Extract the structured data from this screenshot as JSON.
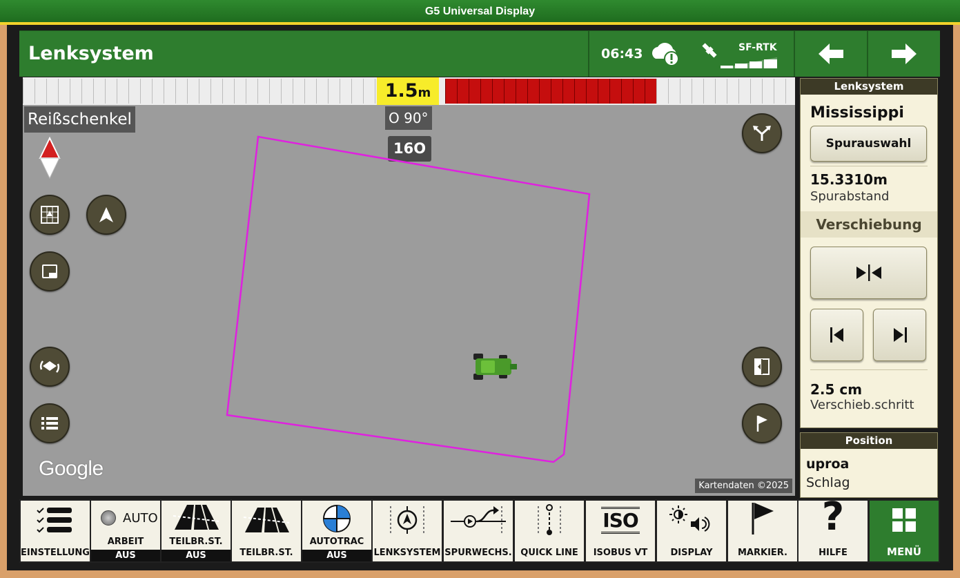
{
  "window": {
    "title": "G5 Universal Display"
  },
  "header": {
    "title": "Lenksystem",
    "time": "06:43",
    "gps_status": "SF-RTK",
    "icons": [
      "cloud-warning-icon",
      "satellite-icon",
      "signal-bars-icon"
    ],
    "back_label": "←",
    "forward_label": "→"
  },
  "map": {
    "lightbar_value": "1.5",
    "lightbar_unit": "m",
    "implement_label": "Reißschenkel",
    "heading_label": "O 90°",
    "track_number": "16O",
    "google_label": "Google",
    "credit": "Kartendaten ©2025",
    "boundary_color": "#e020e0",
    "lightbar_error_color": "#c50e0e"
  },
  "sidepanel": {
    "header": "Lenksystem",
    "track_name": "Mississippi",
    "track_select_label": "Spurauswahl",
    "spacing_value": "15.3310m",
    "spacing_label": "Spurabstand",
    "shift_header": "Verschiebung",
    "step_value": "2.5 cm",
    "step_label": "Verschieb.schritt"
  },
  "position_panel": {
    "header": "Position",
    "field_name": "uproa",
    "field_label": "Schlag"
  },
  "toolbar": {
    "items": [
      {
        "label": "EINSTELLUNG"
      },
      {
        "top": "AUTO",
        "label": "ARBEIT",
        "sub": "AUS"
      },
      {
        "label": "TEILBR.ST.",
        "sub": "AUS"
      },
      {
        "label": "TEILBR.ST."
      },
      {
        "label": "AUTOTRAC",
        "sub": "AUS"
      },
      {
        "label": "LENKSYSTEM"
      },
      {
        "label": "SPURWECHS."
      },
      {
        "label": "QUICK LINE"
      },
      {
        "top": "ISO",
        "label": "ISOBUS VT"
      },
      {
        "label": "DISPLAY"
      },
      {
        "label": "MARKIER."
      },
      {
        "top": "?",
        "label": "HILFE"
      },
      {
        "label": "MENÜ"
      }
    ]
  }
}
